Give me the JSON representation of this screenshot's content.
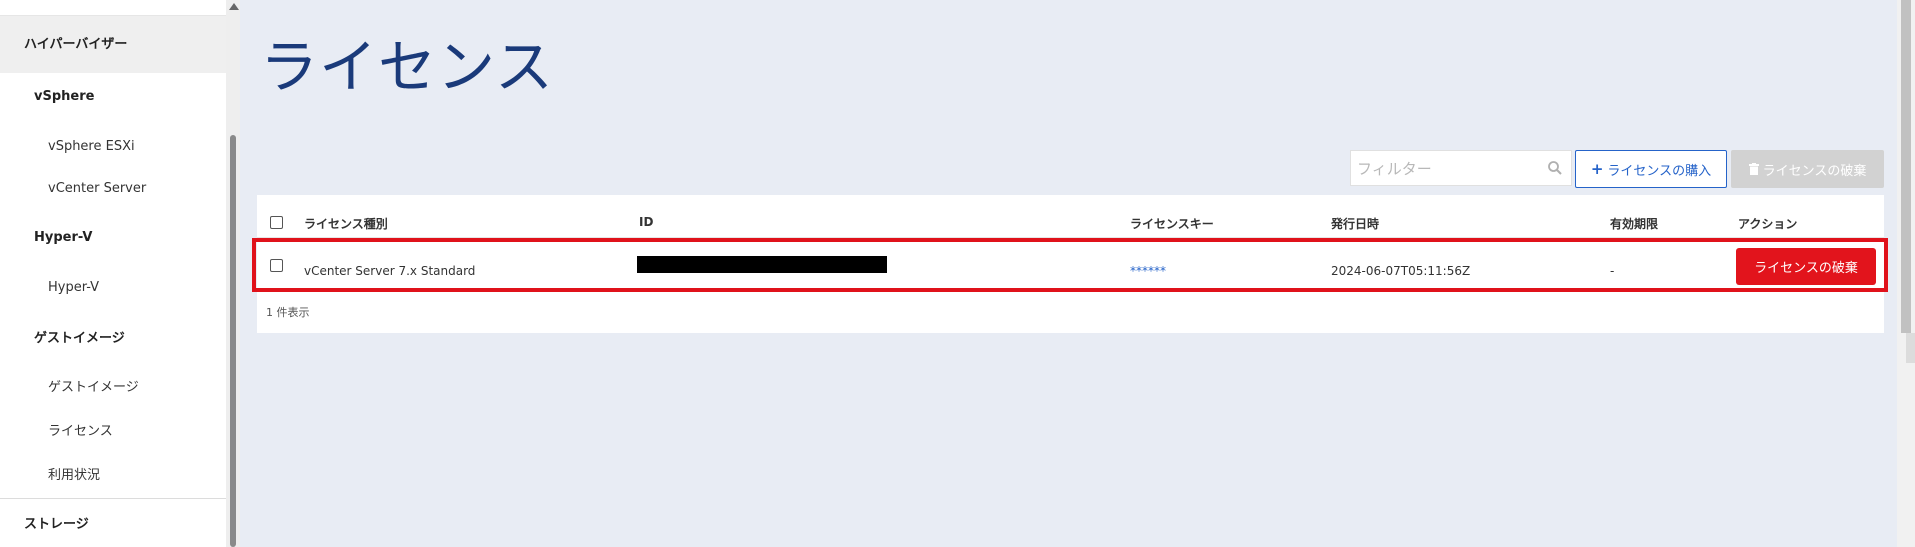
{
  "sidebar": {
    "items": [
      {
        "label": "ハイパーバイザー"
      },
      {
        "label": "vSphere"
      },
      {
        "label": "vSphere ESXi"
      },
      {
        "label": "vCenter Server"
      },
      {
        "label": "Hyper-V"
      },
      {
        "label": "Hyper-V"
      },
      {
        "label": "ゲストイメージ"
      },
      {
        "label": "ゲストイメージ"
      },
      {
        "label": "ライセンス"
      },
      {
        "label": "利用状況"
      },
      {
        "label": "ストレージ"
      }
    ]
  },
  "page": {
    "title": "ライセンス"
  },
  "toolbar": {
    "filter_placeholder": "フィルター",
    "purchase_label": "ライセンスの購入",
    "discard_label": "ライセンスの破棄"
  },
  "table": {
    "columns": [
      "ライセンス種別",
      "ID",
      "ライセンスキー",
      "発行日時",
      "有効期限",
      "アクション"
    ],
    "rows": [
      {
        "type": "vCenter Server 7.x Standard",
        "id": "",
        "key": "******",
        "issued": "2024-06-07T05:11:56Z",
        "expiry": "-",
        "action_label": "ライセンスの破棄"
      }
    ],
    "count_text": "1 件表示"
  },
  "colors": {
    "title": "#1a3a7a",
    "accent_blue": "#2563c9",
    "danger_red": "#e2141c",
    "highlight_red": "#e0121b",
    "background": "#e8ecf4"
  }
}
